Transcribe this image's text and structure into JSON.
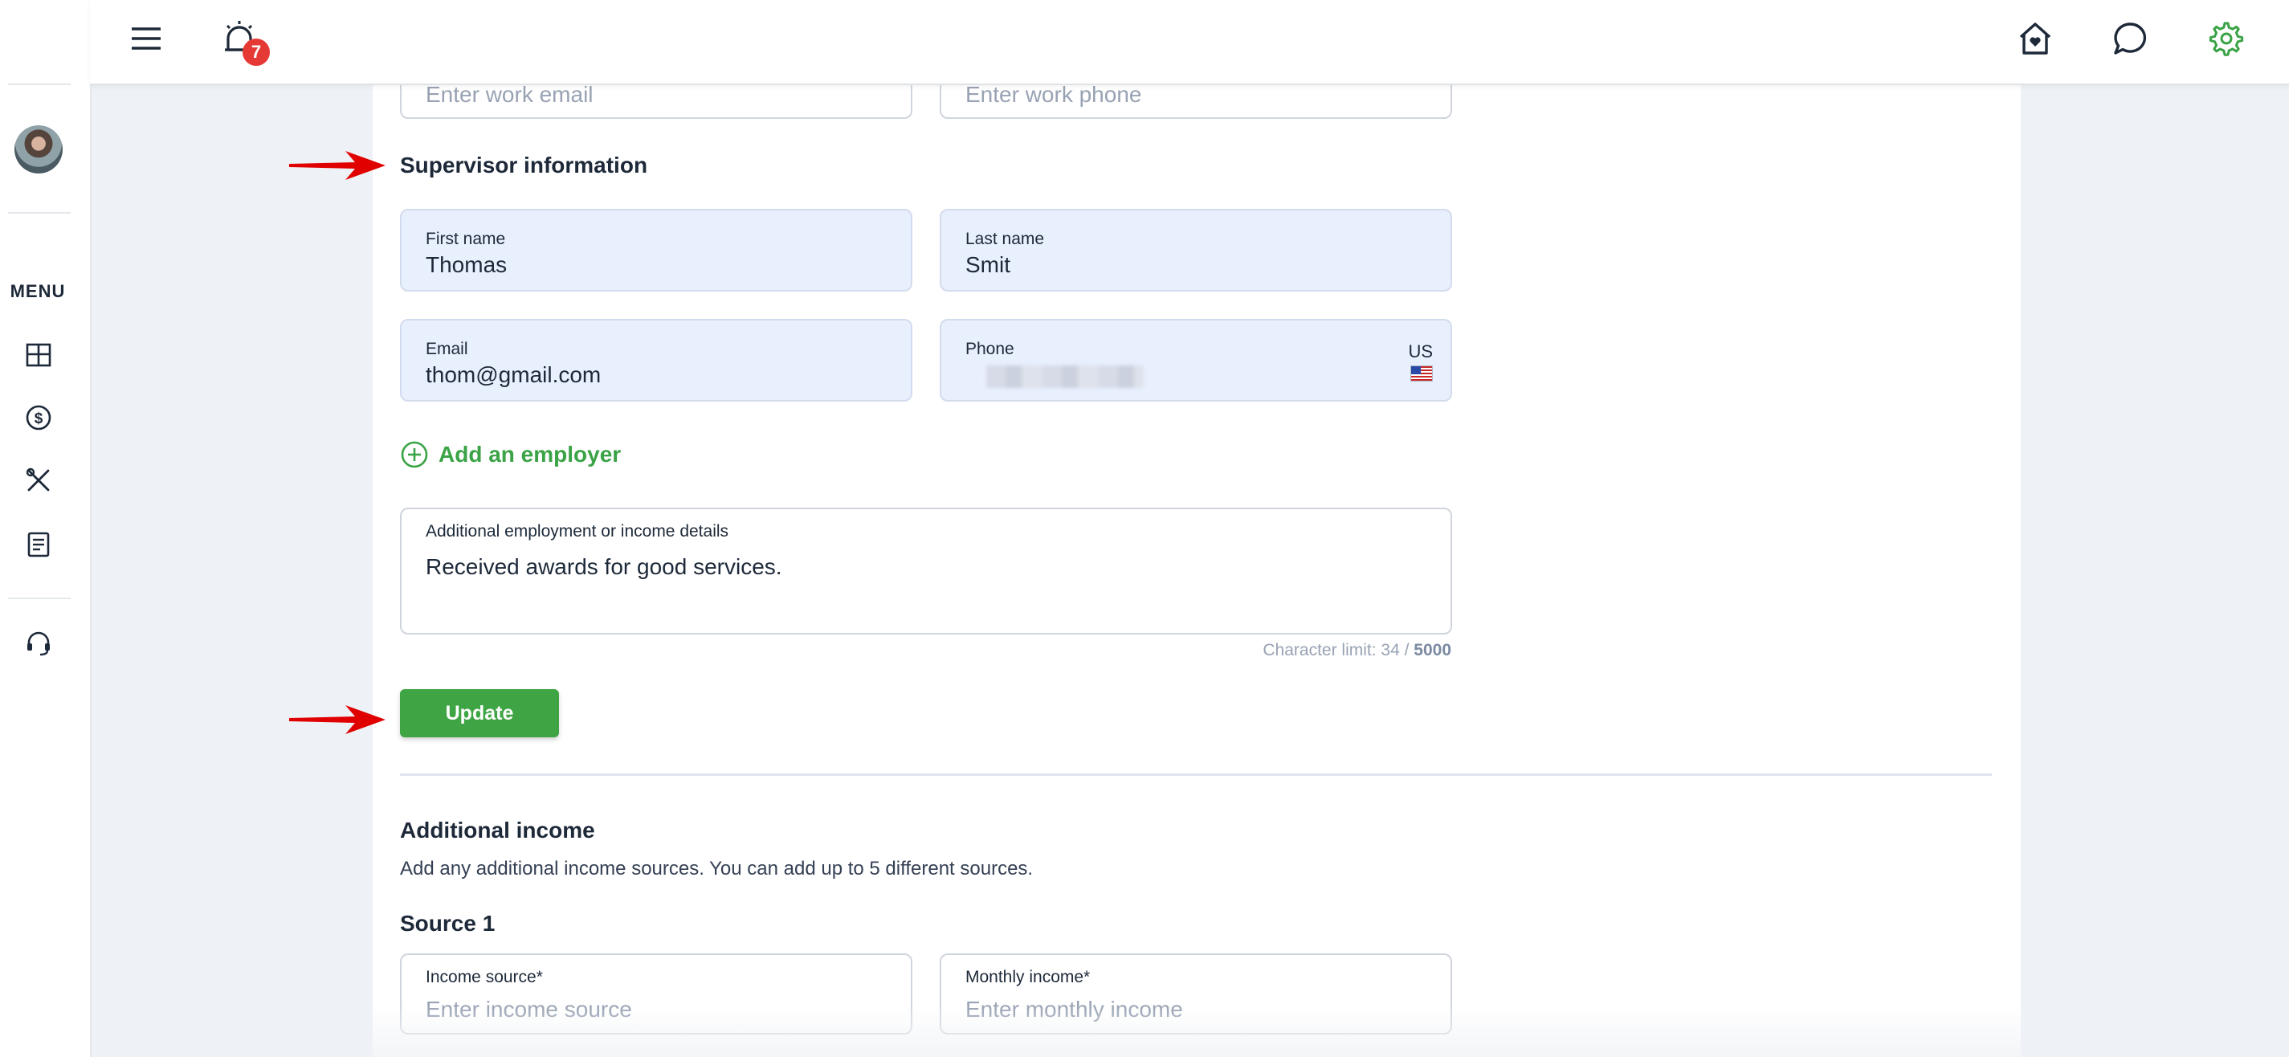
{
  "sidebar": {
    "menu_label": "MENU",
    "items": [
      {
        "name": "dashboard-icon"
      },
      {
        "name": "dollar-icon"
      },
      {
        "name": "tools-icon"
      },
      {
        "name": "document-icon"
      },
      {
        "name": "headset-icon"
      }
    ]
  },
  "topbar": {
    "notification_count": "7",
    "icons": [
      "hamburger-menu-icon",
      "alarm-bell-icon",
      "home-heart-icon",
      "chat-bubble-icon",
      "gear-icon"
    ],
    "colors": {
      "settings_icon": "#3aa346"
    }
  },
  "work_contact": {
    "email_placeholder": "Enter work email",
    "phone_placeholder": "Enter work phone"
  },
  "supervisor": {
    "title": "Supervisor information",
    "first_name": {
      "label": "First name",
      "value": "Thomas"
    },
    "last_name": {
      "label": "Last name",
      "value": "Smit"
    },
    "email": {
      "label": "Email",
      "value": "thom@gmail.com"
    },
    "phone": {
      "label": "Phone",
      "country": "US"
    }
  },
  "add_employer_label": "Add an employer",
  "additional_details": {
    "label": "Additional employment or income details",
    "value": "Received awards for good services.",
    "char_limit_prefix": "Character limit: 34 / ",
    "char_limit_max": "5000"
  },
  "update_button": "Update",
  "additional_income": {
    "title": "Additional income",
    "description": "Add any additional income sources. You can add up to 5 different sources.",
    "source_title": "Source 1",
    "income_source": {
      "label": "Income source*",
      "placeholder": "Enter income source"
    },
    "monthly_income": {
      "label": "Monthly income*",
      "placeholder": "Enter monthly income"
    }
  },
  "colors": {
    "accent": "#3fa544",
    "annotation_arrow": "#e00000",
    "badge": "#e53935"
  }
}
